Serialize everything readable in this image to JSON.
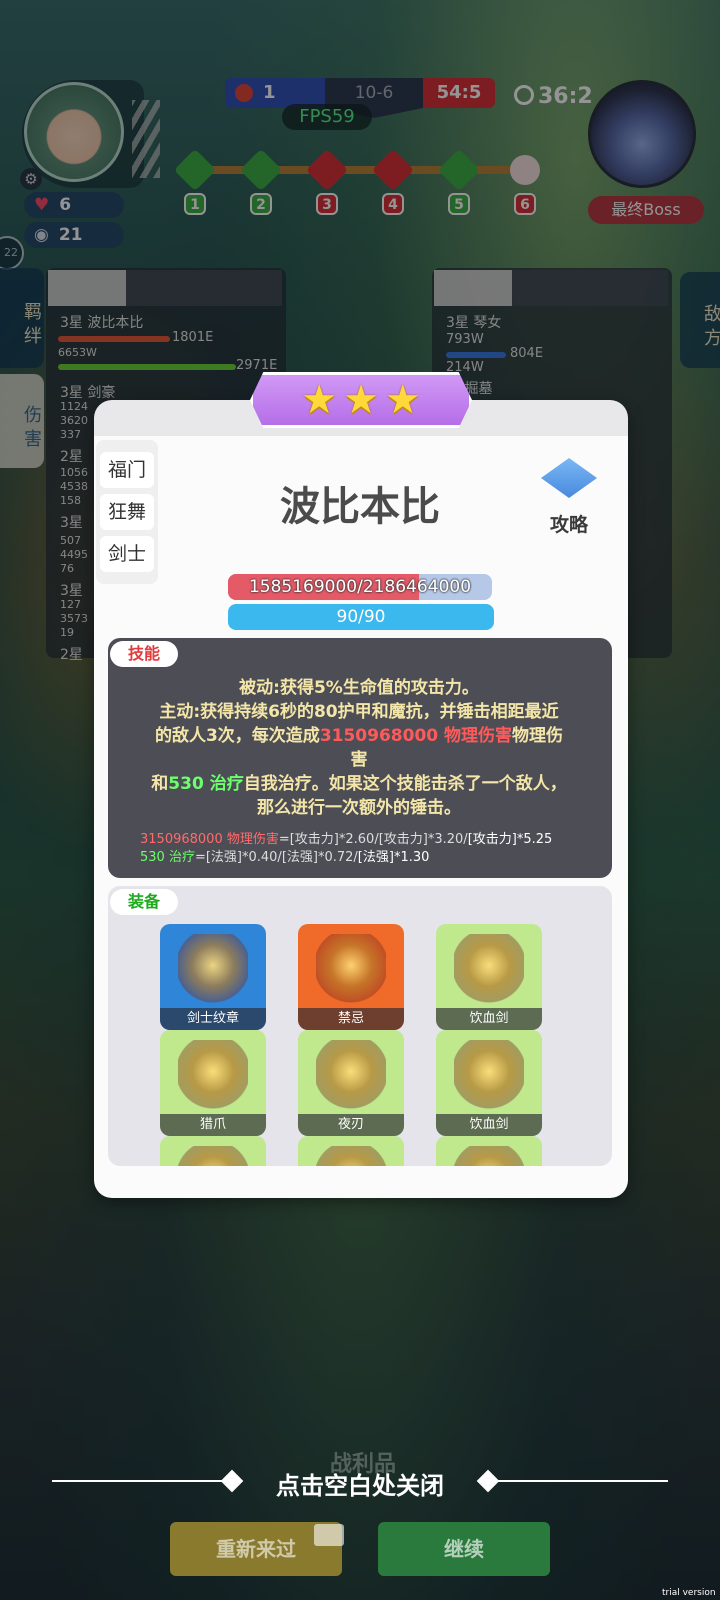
{
  "hud": {
    "lives": "6",
    "coins": "21",
    "blue_score": "1",
    "round": "10-6",
    "red_score": "54:5",
    "fps": "FPS59",
    "timer": "36:2",
    "boss_label": "最终Boss",
    "side_level": "22",
    "stages": [
      "1",
      "2",
      "3",
      "4",
      "5",
      "6"
    ]
  },
  "side_tabs": {
    "left_top": "羁绊",
    "left_bottom": "伤害",
    "right_top": "敌方"
  },
  "background_left": {
    "rows": [
      {
        "label": "3星 波比本比",
        "v1": "1801E",
        "v2": "6653W",
        "v3": "2971E"
      },
      {
        "label": "3星 剑豪",
        "extra": [
          "1124",
          "3620",
          "337"
        ]
      },
      {
        "label": "2星",
        "extra": [
          "1056",
          "4538",
          "158"
        ]
      },
      {
        "label": "3星",
        "extra": [
          "507",
          "4495",
          "76"
        ]
      },
      {
        "label": "3星",
        "extra": [
          "127",
          "3573",
          "19"
        ]
      },
      {
        "label": "2星"
      }
    ]
  },
  "background_right": {
    "rows": [
      {
        "label": "3星 琴女",
        "v1": "793W",
        "v2": "804E",
        "v3": "214W"
      },
      {
        "label": "星 掘墓"
      }
    ]
  },
  "modal": {
    "stars": 3,
    "hero_name": "波比本比",
    "guide_label": "攻略",
    "traits": [
      "福门",
      "狂舞",
      "剑士"
    ],
    "hp_text": "1585169000/2186464000",
    "hp_fraction": 0.725,
    "mp_text": "90/90",
    "skill_tag": "技能",
    "skill_line1": "被动:获得5%生命值的攻击力。",
    "skill_line2": "主动:获得持续6秒的80护甲和魔抗，并锤击相距最近",
    "skill_line3a": "的敌人3次，每次造成",
    "skill_phys_value": "3150968000 物理伤害",
    "skill_line3b": "物理伤",
    "skill_line4": "害",
    "skill_line5a": "和",
    "skill_heal_value": "530 治疗",
    "skill_line5b": "自我治疗。如果这个技能击杀了一个敌人，",
    "skill_line6": "那么进行一次额外的锤击。",
    "formula1_red": "3150968000 物理伤害",
    "formula1_rest": "=[攻击力]*2.60/[攻击力]*3.20/",
    "formula1_white": "[攻击力]*5.25",
    "formula2_green": "530 治疗",
    "formula2_rest": "=[法强]*0.40/[法强]*0.72/",
    "formula2_white": "[法强]*1.30",
    "equip_tag": "装备",
    "equipment": [
      {
        "name": "剑士纹章",
        "bg": "#2f86d8"
      },
      {
        "name": "禁忌",
        "bg": "#f06a2a"
      },
      {
        "name": "饮血剑",
        "bg": "#bfe98c"
      },
      {
        "name": "猎爪",
        "bg": "#bfe98c"
      },
      {
        "name": "夜刃",
        "bg": "#bfe98c"
      },
      {
        "name": "饮血剑",
        "bg": "#bfe98c"
      },
      {
        "name": "",
        "bg": "#bfe98c"
      },
      {
        "name": "",
        "bg": "#bfe98c"
      },
      {
        "name": "",
        "bg": "#bfe98c"
      }
    ]
  },
  "bottom": {
    "close_hint": "点击空白处关闭",
    "loot_label": "战利品",
    "retry_label": "重新来过",
    "continue_label": "继续",
    "watermark": "trial version"
  }
}
